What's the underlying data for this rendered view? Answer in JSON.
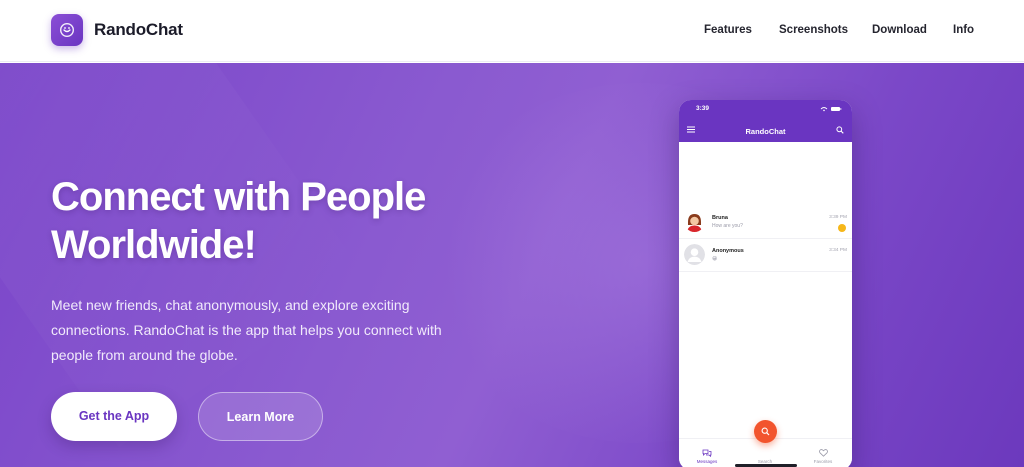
{
  "brand": {
    "name": "RandoChat"
  },
  "nav": [
    {
      "label": "Features"
    },
    {
      "label": "Screenshots"
    },
    {
      "label": "Download"
    },
    {
      "label": "Info"
    }
  ],
  "hero": {
    "headline_line1": "Connect with People",
    "headline_line2": "Worldwide!",
    "subtext": "Meet new friends, chat anonymously, and explore exciting connections. RandoChat is the app that helps you connect with people from around the globe.",
    "primary_button": "Get the App",
    "secondary_button": "Learn More"
  },
  "phone": {
    "time": "3:39",
    "title": "RandoChat",
    "chats": [
      {
        "name": "Bruna",
        "message": "How are you?",
        "time": "3:39 PM",
        "unread": true
      },
      {
        "name": "Anonymous",
        "message": "😀",
        "time": "3:34 PM",
        "unread": false
      }
    ],
    "tabs": [
      {
        "label": "Messages",
        "icon": "messages-icon"
      },
      {
        "label": "Search",
        "icon": "search-icon"
      },
      {
        "label": "Favorites",
        "icon": "heart-icon"
      }
    ]
  },
  "colors": {
    "accent": "#6a35c1",
    "hero_gradient_start": "#7a45c9",
    "hero_gradient_end": "#6c39bd",
    "fab": "#f2542d",
    "badge": "#f6b71a"
  }
}
